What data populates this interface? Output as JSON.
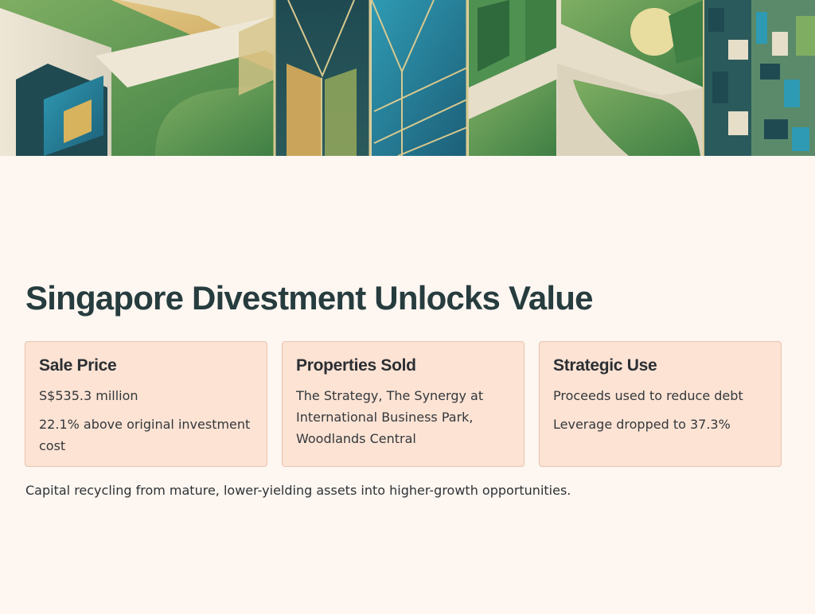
{
  "title": "Singapore Divestment Unlocks Value",
  "cards": [
    {
      "heading": "Sale Price",
      "lines": [
        "S$535.3 million",
        "22.1% above original investment cost"
      ]
    },
    {
      "heading": "Properties Sold",
      "lines": [
        "The Strategy, The Synergy at International Business Park, Woodlands Central"
      ]
    },
    {
      "heading": "Strategic Use",
      "lines": [
        "Proceeds used to reduce debt",
        "Leverage dropped to 37.3%"
      ]
    }
  ],
  "note": "Capital recycling from mature, lower-yielding assets into higher-growth opportunities.",
  "colors": {
    "background": "#fdf6f1",
    "card_fill": "#fce3d4",
    "card_border": "#e8c4ad",
    "heading_text": "#263c3e"
  }
}
